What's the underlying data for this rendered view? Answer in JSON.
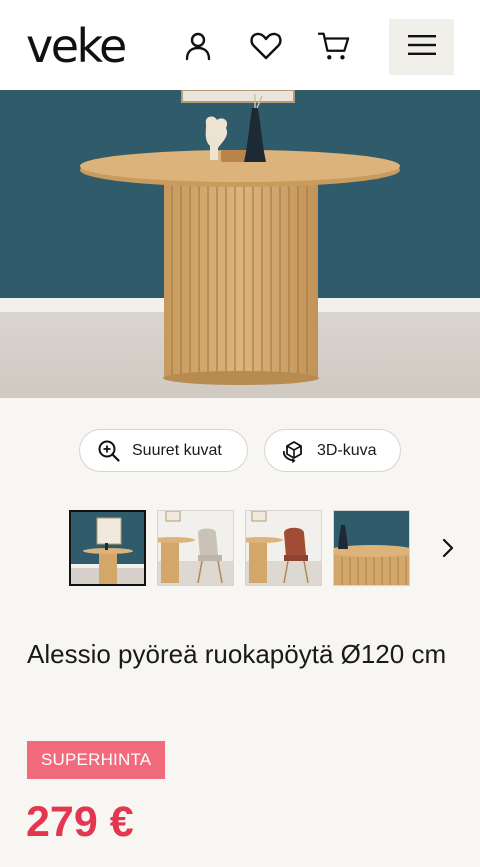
{
  "header": {
    "logo": "veke",
    "icons": [
      "user-icon",
      "heart-icon",
      "cart-icon",
      "menu-icon"
    ]
  },
  "actions": {
    "large_images": "Suuret kuvat",
    "view_3d": "3D-kuva"
  },
  "gallery": {
    "thumbnails": [
      "table-only",
      "table-with-grey-chair",
      "table-with-brown-chair",
      "table-closeup"
    ],
    "active_index": 0
  },
  "product": {
    "name": "Alessio pyöreä ruokapöytä Ø120 cm",
    "badge": "SUPERHINTA",
    "price": "279 €"
  },
  "colors": {
    "wall": "#2f5b6a",
    "wood": "#d9b27a",
    "badge": "#f26b7c",
    "price": "#e2374f",
    "menu_bg": "#f1efea"
  }
}
